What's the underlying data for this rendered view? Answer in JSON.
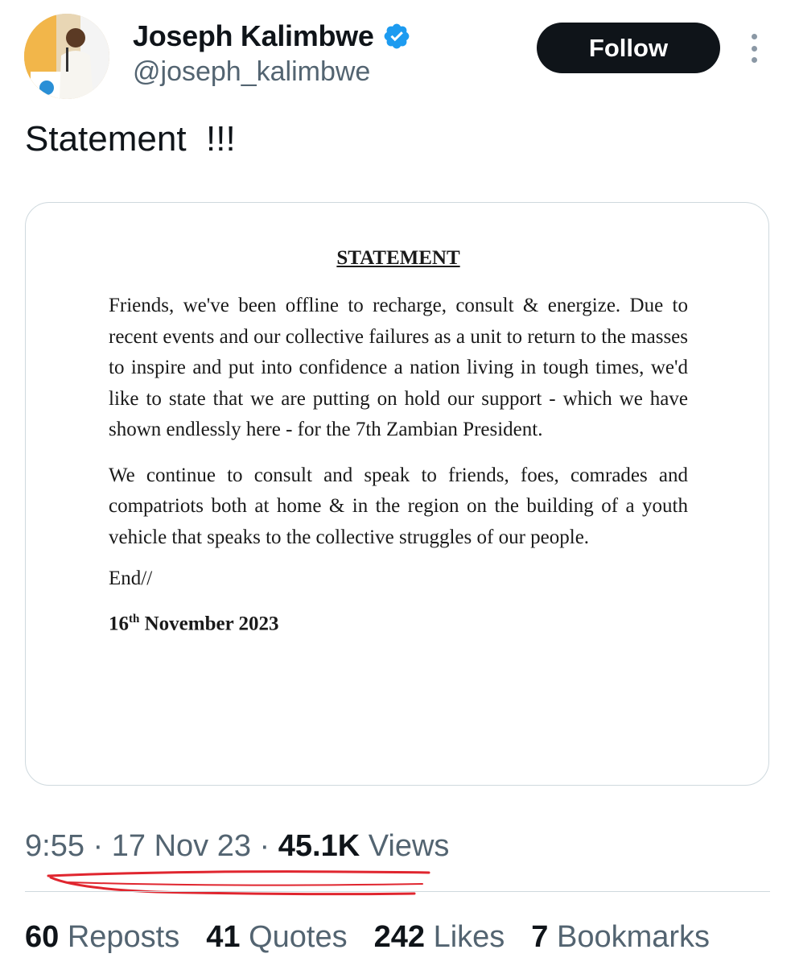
{
  "author": {
    "display_name": "Joseph Kalimbwe",
    "handle": "@joseph_kalimbwe"
  },
  "follow_label": "Follow",
  "tweet_text": "Statement  !!!",
  "document": {
    "title": "STATEMENT",
    "paragraph_1": "Friends, we've been offline to recharge, consult & energize. Due to recent events and our collective failures as a unit to return to the masses to inspire and put into confidence a nation living in tough times, we'd like to state that we are putting on hold our support - which we have shown endlessly here - for the 7th Zambian President.",
    "paragraph_2": "We continue to consult and speak to friends, foes, comrades and compatriots both at home & in the region on the building of a youth vehicle that speaks to the collective struggles of our people.",
    "end": "End//",
    "date_day": "16",
    "date_suffix": "th",
    "date_rest": " November 2023"
  },
  "meta": {
    "time": "9:55",
    "separator": " · ",
    "date": "17 Nov 23",
    "views_count": "45.1K",
    "views_label": " Views"
  },
  "stats": {
    "reposts_count": "60",
    "reposts_label": " Reposts",
    "quotes_count": "41",
    "quotes_label": " Quotes",
    "likes_count": "242",
    "likes_label": " Likes",
    "bookmarks_count": "7",
    "bookmarks_label": " Bookmarks"
  },
  "colors": {
    "verified": "#1d9bf0",
    "text_primary": "#0f1419",
    "text_secondary": "#536471",
    "annotation_red": "#e0262f"
  },
  "icons": [
    "verified-badge-icon",
    "more-options-icon"
  ]
}
